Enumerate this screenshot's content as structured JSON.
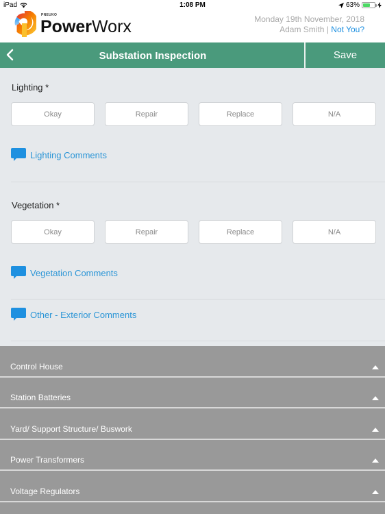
{
  "status_bar": {
    "device": "iPad",
    "time": "1:08 PM",
    "battery_percent": "63%",
    "battery_level": 0.63
  },
  "header": {
    "logo_sub": "PNEUKO",
    "logo_bold": "Power",
    "logo_light": "Worx",
    "date": "Monday 19th November, 2018",
    "user_name": "Adam Smith",
    "separator": "|",
    "not_you": "Not You?"
  },
  "nav": {
    "title": "Substation Inspection",
    "save_label": "Save",
    "back_icon": "chevron-left-icon"
  },
  "sections": [
    {
      "label": "Lighting *",
      "options": [
        "Okay",
        "Repair",
        "Replace",
        "N/A"
      ],
      "comment_label": "Lighting Comments"
    },
    {
      "label": "Vegetation *",
      "options": [
        "Okay",
        "Repair",
        "Replace",
        "N/A"
      ],
      "comment_label": "Vegetation Comments"
    }
  ],
  "other_comment_label": "Other - Exterior Comments",
  "accordion": [
    {
      "label": "Control House"
    },
    {
      "label": "Station Batteries"
    },
    {
      "label": "Yard/ Support Structure/ Buswork"
    },
    {
      "label": "Power Transformers"
    },
    {
      "label": "Voltage Regulators"
    }
  ],
  "colors": {
    "nav_green": "#4a9a7c",
    "link_blue": "#2b95d6",
    "accordion_gray": "#999999",
    "battery_green": "#4cd964"
  }
}
